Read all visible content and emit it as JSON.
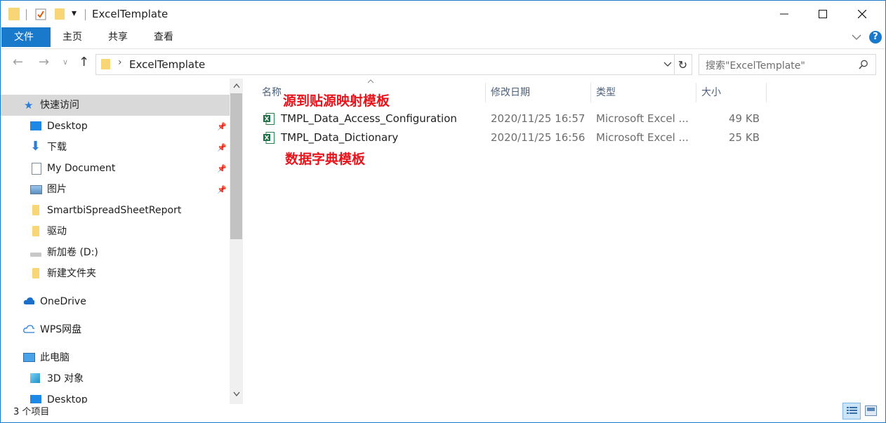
{
  "window": {
    "title": "ExcelTemplate",
    "quick_access_dropdown": "▾"
  },
  "ribbon": {
    "tabs": [
      "文件",
      "主页",
      "共享",
      "查看"
    ]
  },
  "address": {
    "crumb": "ExcelTemplate",
    "search_placeholder": "搜索\"ExcelTemplate\""
  },
  "nav_pane": {
    "quick_access": "快速访问",
    "items": [
      {
        "label": "Desktop",
        "icon": "desktop-icon",
        "pinned": true
      },
      {
        "label": "下载",
        "icon": "download-icon",
        "pinned": true
      },
      {
        "label": "My Document",
        "icon": "document-icon",
        "pinned": true
      },
      {
        "label": "图片",
        "icon": "picture-icon",
        "pinned": true
      },
      {
        "label": "SmartbiSpreadSheetReport",
        "icon": "folder-icon",
        "pinned": false
      },
      {
        "label": "驱动",
        "icon": "folder-icon",
        "pinned": false
      },
      {
        "label": "新加卷 (D:)",
        "icon": "drive-icon",
        "pinned": false
      },
      {
        "label": "新建文件夹",
        "icon": "folder-icon",
        "pinned": false
      }
    ],
    "onedrive": "OneDrive",
    "wps": "WPS网盘",
    "this_pc": "此电脑",
    "pc_items": [
      "3D 对象",
      "Desktop"
    ]
  },
  "columns": {
    "name": "名称",
    "modified": "修改日期",
    "type": "类型",
    "size": "大小"
  },
  "files": [
    {
      "name": "TMPL_Data_Access_Configuration",
      "modified": "2020/11/25 16:57",
      "type": "Microsoft Excel ...",
      "size": "49 KB"
    },
    {
      "name": "TMPL_Data_Dictionary",
      "modified": "2020/11/25 16:56",
      "type": "Microsoft Excel ...",
      "size": "25 KB"
    }
  ],
  "annotations": {
    "first": "源到贴源映射模板",
    "second": "数据字典模板"
  },
  "status_bar": {
    "count": "3 个项目"
  },
  "colors": {
    "accent": "#1979ca",
    "annotation": "#e8141b",
    "folder": "#f8d675",
    "nav_selected": "#d9d9d9"
  }
}
